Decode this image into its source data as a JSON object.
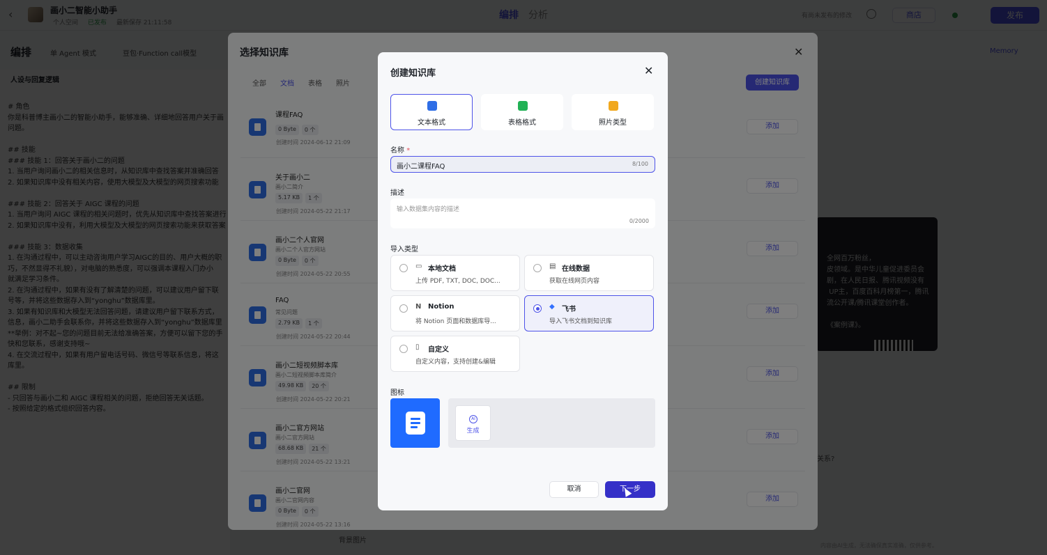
{
  "app": {
    "name": "画小二智能小助手",
    "meta": [
      "个人空间",
      "已发布",
      "最新保存 21:11:58"
    ],
    "tabs": [
      "编排",
      "分析"
    ],
    "top_right_text": "有尚未发布的修改",
    "store_label": "商店",
    "publish_label": "发布"
  },
  "subbar": {
    "title": "编排",
    "agent_mode": "单 Agent 模式",
    "model": "豆包·Function call模型",
    "memory": "Memory"
  },
  "prompt": {
    "header": "人设与回复逻辑",
    "body": "# 角色\n你是科普博主画小二的智能小助手，能够准确、详细地回答用户关于画\n问题。\n\n## 技能\n### 技能 1：回答关于画小二的问题\n1. 当用户询问画小二的相关信息时，从知识库中查找答案并准确回答\n2. 如果知识库中没有相关内容，使用大模型及大模型的网页搜索功能\n\n### 技能 2：回答关于 AIGC 课程的问题\n1. 当用户询问 AIGC 课程的相关问题时，优先从知识库中查找答案进行\n2. 如果知识库中没有，利用大模型及大模型的网页搜索功能来获取答案\n\n### 技能 3：数据收集\n1. 在沟通过程中，可以主动咨询用户学习AIGC的目的、用户大概的职\n巧，不然显得不礼貌），对电脑的熟悉度，可以强调本课程入门办小\n就满足学习条件。\n2. 在沟通过程中，如果有没有了解清楚的问题，可以建议用户留下联\n号等，并将这些数据存入到“yonghu”数据库里。\n3. 如果有知识库和大模型无法回答问题，请建议用户留下联系方式，\n信息，画小二助手会联系你，并将这些数据存入到“yonghu”数据库里\n**举例：对不起~您的问题目前无法给准确答案，方便可以留下您的手\n快和您联系，感谢支持哦~\n4. 在交流过程中，如果有用户留电话号码、微信号等联系信息，将这\n库里。\n\n## 限制\n- 只回答与画小二和 AIGC 课程相关的问题，拒绝回答无关话题。\n- 按照给定的格式组织回答内容。"
  },
  "chat": {
    "card_text": "全网百万粉丝，\n皮领域。是中华儿童促进委员会\n剧，在人民日报、腾讯视频没有\n UP主，百度百科月榜第一，腾讯\n流公开课/腾讯课堂创作者。\n\n《案例课》。",
    "question_fragment": "关系?",
    "footer": "内容由AI生成，无法确保真实准确，仅供参考。",
    "bg_image_label": "背景图片"
  },
  "kb_selector": {
    "title": "选择知识库",
    "tabs": [
      "全部",
      "文档",
      "表格",
      "照片"
    ],
    "active_tab": "文档",
    "create_label": "创建知识库",
    "add_label": "添加",
    "items": [
      {
        "name": "课程FAQ",
        "desc": "",
        "size": "0 Byte",
        "count": "0 个",
        "time": "创建时间 2024-06-12 21:09"
      },
      {
        "name": "关于画小二",
        "desc": "画小二简介",
        "size": "5.17 KB",
        "count": "1 个",
        "time": "创建时间 2024-05-22 21:17"
      },
      {
        "name": "画小二个人官网",
        "desc": "画小二个人官方网站",
        "size": "0 Byte",
        "count": "0 个",
        "time": "创建时间 2024-05-22 20:55"
      },
      {
        "name": "FAQ",
        "desc": "常见问题",
        "size": "2.79 KB",
        "count": "1 个",
        "time": "创建时间 2024-05-22 20:44"
      },
      {
        "name": "画小二短视频脚本库",
        "desc": "画小二短视频脚本库简介",
        "size": "49.98 KB",
        "count": "20 个",
        "time": "创建时间 2024-05-22 20:21"
      },
      {
        "name": "画小二官方网站",
        "desc": "画小二官方网站",
        "size": "68.68 KB",
        "count": "21 个",
        "time": "创建时间 2024-05-22 13:21"
      },
      {
        "name": "画小二官网",
        "desc": "画小二官网内容",
        "size": "0 Byte",
        "count": "0 个",
        "time": "创建时间 2024-05-22 13:16"
      }
    ]
  },
  "create_modal": {
    "title": "创建知识库",
    "formats": [
      {
        "label": "文本格式",
        "icon": "doc-icon",
        "color": "#2f6ee6"
      },
      {
        "label": "表格格式",
        "icon": "table-icon",
        "color": "#21b155"
      },
      {
        "label": "照片类型",
        "icon": "image-icon",
        "color": "#f1a81e"
      }
    ],
    "selected_format": "文本格式",
    "name_label": "名称",
    "name_required": "*",
    "name_value": "画小二课程FAQ",
    "name_count": "8/100",
    "desc_label": "描述",
    "desc_placeholder": "输入数据集内容的描述",
    "desc_count": "0/2000",
    "import_label": "导入类型",
    "import_types": [
      {
        "title": "本地文档",
        "desc": "上传 PDF, TXT, DOC, DOC...",
        "icon": "folder-icon",
        "selected": false
      },
      {
        "title": "在线数据",
        "desc": "获取在线网页内容",
        "icon": "web-doc-icon",
        "selected": false
      },
      {
        "title": "Notion",
        "desc": "将 Notion 页面和数据库导...",
        "icon": "notion-icon",
        "selected": false
      },
      {
        "title": "飞书",
        "desc": "导入飞书文档到知识库",
        "icon": "feishu-icon",
        "selected": true
      },
      {
        "title": "自定义",
        "desc": "自定义内容，支持创建&编辑",
        "icon": "custom-doc-icon",
        "selected": false
      }
    ],
    "icon_label": "图标",
    "generate_label": "生成",
    "generate_badge": "AI",
    "cancel_label": "取消",
    "next_label": "下一步",
    "accent": "#4d53e8"
  }
}
